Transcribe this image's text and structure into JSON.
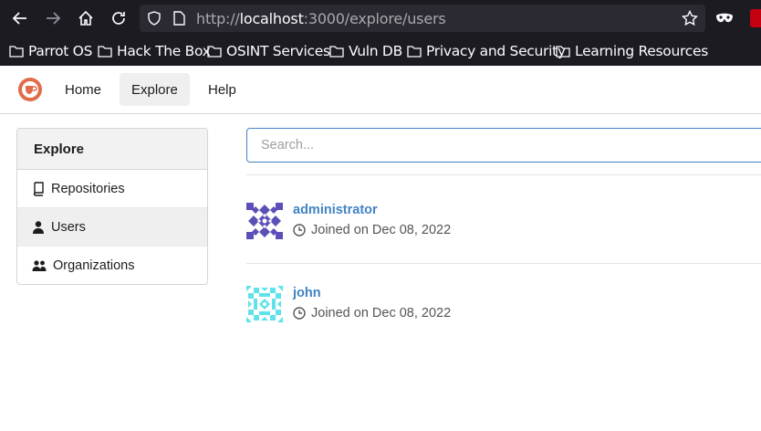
{
  "browser": {
    "url_prefix": "http://",
    "url_host": "localhost",
    "url_rest": ":3000/explore/users",
    "bookmarks": [
      "Parrot OS",
      "Hack The Box",
      "OSINT Services",
      "Vuln DB",
      "Privacy and Security",
      "Learning Resources"
    ]
  },
  "header": {
    "nav": [
      "Home",
      "Explore",
      "Help"
    ],
    "active": "Explore"
  },
  "sidebar": {
    "title": "Explore",
    "items": [
      {
        "label": "Repositories",
        "icon": "repo-icon"
      },
      {
        "label": "Users",
        "icon": "person-icon"
      },
      {
        "label": "Organizations",
        "icon": "organization-icon"
      }
    ],
    "active": "Users"
  },
  "search": {
    "placeholder": "Search..."
  },
  "users": [
    {
      "name": "administrator",
      "joined": "Joined on Dec 08, 2022",
      "avatar_color": "#5b4fb8"
    },
    {
      "name": "john",
      "joined": "Joined on Dec 08, 2022",
      "avatar_color": "#5fe3e8"
    }
  ],
  "colors": {
    "link": "#4183c4",
    "chrome_bg": "#1c1b22",
    "gitea_logo": "#e06c4a"
  }
}
